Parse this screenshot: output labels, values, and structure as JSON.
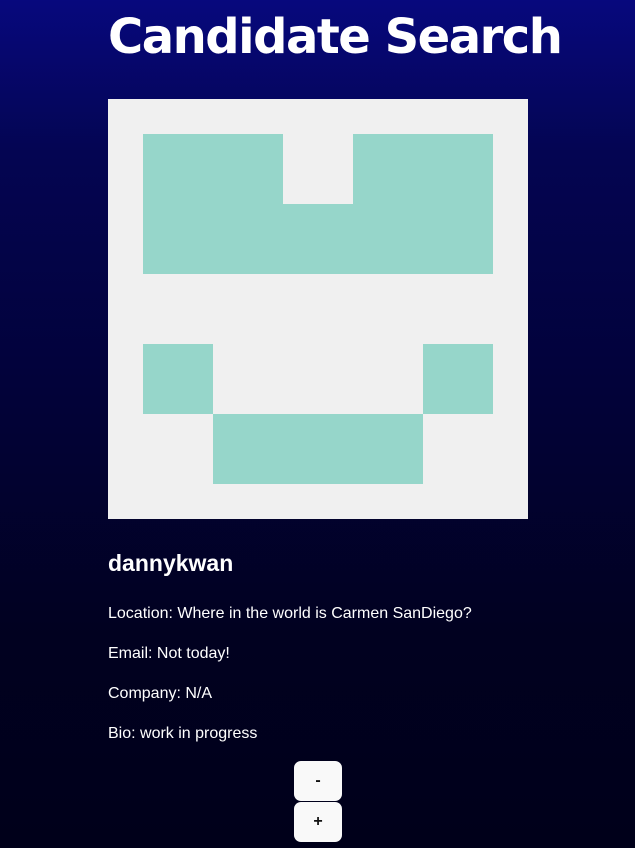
{
  "page": {
    "title": "Candidate Search"
  },
  "candidate": {
    "avatar": {
      "description": "identicon",
      "background_color": "#f0f0f0",
      "fill_color": "#96d6ca"
    },
    "username": "dannykwan",
    "location": "Location: Where in the world is Carmen SanDiego?",
    "email": "Email: Not today!",
    "company": "Company: N/A",
    "bio": "Bio: work in progress"
  },
  "actions": {
    "reject_label": "-",
    "accept_label": "+"
  }
}
